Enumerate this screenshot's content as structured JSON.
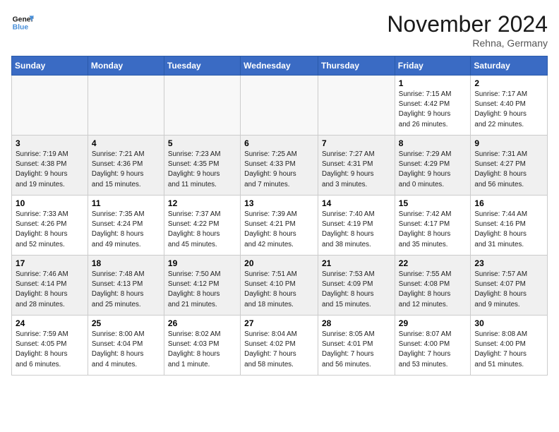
{
  "header": {
    "logo_line1": "General",
    "logo_line2": "Blue",
    "month": "November 2024",
    "location": "Rehna, Germany"
  },
  "weekdays": [
    "Sunday",
    "Monday",
    "Tuesday",
    "Wednesday",
    "Thursday",
    "Friday",
    "Saturday"
  ],
  "weeks": [
    [
      {
        "day": "",
        "info": ""
      },
      {
        "day": "",
        "info": ""
      },
      {
        "day": "",
        "info": ""
      },
      {
        "day": "",
        "info": ""
      },
      {
        "day": "",
        "info": ""
      },
      {
        "day": "1",
        "info": "Sunrise: 7:15 AM\nSunset: 4:42 PM\nDaylight: 9 hours\nand 26 minutes."
      },
      {
        "day": "2",
        "info": "Sunrise: 7:17 AM\nSunset: 4:40 PM\nDaylight: 9 hours\nand 22 minutes."
      }
    ],
    [
      {
        "day": "3",
        "info": "Sunrise: 7:19 AM\nSunset: 4:38 PM\nDaylight: 9 hours\nand 19 minutes."
      },
      {
        "day": "4",
        "info": "Sunrise: 7:21 AM\nSunset: 4:36 PM\nDaylight: 9 hours\nand 15 minutes."
      },
      {
        "day": "5",
        "info": "Sunrise: 7:23 AM\nSunset: 4:35 PM\nDaylight: 9 hours\nand 11 minutes."
      },
      {
        "day": "6",
        "info": "Sunrise: 7:25 AM\nSunset: 4:33 PM\nDaylight: 9 hours\nand 7 minutes."
      },
      {
        "day": "7",
        "info": "Sunrise: 7:27 AM\nSunset: 4:31 PM\nDaylight: 9 hours\nand 3 minutes."
      },
      {
        "day": "8",
        "info": "Sunrise: 7:29 AM\nSunset: 4:29 PM\nDaylight: 9 hours\nand 0 minutes."
      },
      {
        "day": "9",
        "info": "Sunrise: 7:31 AM\nSunset: 4:27 PM\nDaylight: 8 hours\nand 56 minutes."
      }
    ],
    [
      {
        "day": "10",
        "info": "Sunrise: 7:33 AM\nSunset: 4:26 PM\nDaylight: 8 hours\nand 52 minutes."
      },
      {
        "day": "11",
        "info": "Sunrise: 7:35 AM\nSunset: 4:24 PM\nDaylight: 8 hours\nand 49 minutes."
      },
      {
        "day": "12",
        "info": "Sunrise: 7:37 AM\nSunset: 4:22 PM\nDaylight: 8 hours\nand 45 minutes."
      },
      {
        "day": "13",
        "info": "Sunrise: 7:39 AM\nSunset: 4:21 PM\nDaylight: 8 hours\nand 42 minutes."
      },
      {
        "day": "14",
        "info": "Sunrise: 7:40 AM\nSunset: 4:19 PM\nDaylight: 8 hours\nand 38 minutes."
      },
      {
        "day": "15",
        "info": "Sunrise: 7:42 AM\nSunset: 4:17 PM\nDaylight: 8 hours\nand 35 minutes."
      },
      {
        "day": "16",
        "info": "Sunrise: 7:44 AM\nSunset: 4:16 PM\nDaylight: 8 hours\nand 31 minutes."
      }
    ],
    [
      {
        "day": "17",
        "info": "Sunrise: 7:46 AM\nSunset: 4:14 PM\nDaylight: 8 hours\nand 28 minutes."
      },
      {
        "day": "18",
        "info": "Sunrise: 7:48 AM\nSunset: 4:13 PM\nDaylight: 8 hours\nand 25 minutes."
      },
      {
        "day": "19",
        "info": "Sunrise: 7:50 AM\nSunset: 4:12 PM\nDaylight: 8 hours\nand 21 minutes."
      },
      {
        "day": "20",
        "info": "Sunrise: 7:51 AM\nSunset: 4:10 PM\nDaylight: 8 hours\nand 18 minutes."
      },
      {
        "day": "21",
        "info": "Sunrise: 7:53 AM\nSunset: 4:09 PM\nDaylight: 8 hours\nand 15 minutes."
      },
      {
        "day": "22",
        "info": "Sunrise: 7:55 AM\nSunset: 4:08 PM\nDaylight: 8 hours\nand 12 minutes."
      },
      {
        "day": "23",
        "info": "Sunrise: 7:57 AM\nSunset: 4:07 PM\nDaylight: 8 hours\nand 9 minutes."
      }
    ],
    [
      {
        "day": "24",
        "info": "Sunrise: 7:59 AM\nSunset: 4:05 PM\nDaylight: 8 hours\nand 6 minutes."
      },
      {
        "day": "25",
        "info": "Sunrise: 8:00 AM\nSunset: 4:04 PM\nDaylight: 8 hours\nand 4 minutes."
      },
      {
        "day": "26",
        "info": "Sunrise: 8:02 AM\nSunset: 4:03 PM\nDaylight: 8 hours\nand 1 minute."
      },
      {
        "day": "27",
        "info": "Sunrise: 8:04 AM\nSunset: 4:02 PM\nDaylight: 7 hours\nand 58 minutes."
      },
      {
        "day": "28",
        "info": "Sunrise: 8:05 AM\nSunset: 4:01 PM\nDaylight: 7 hours\nand 56 minutes."
      },
      {
        "day": "29",
        "info": "Sunrise: 8:07 AM\nSunset: 4:00 PM\nDaylight: 7 hours\nand 53 minutes."
      },
      {
        "day": "30",
        "info": "Sunrise: 8:08 AM\nSunset: 4:00 PM\nDaylight: 7 hours\nand 51 minutes."
      }
    ]
  ]
}
